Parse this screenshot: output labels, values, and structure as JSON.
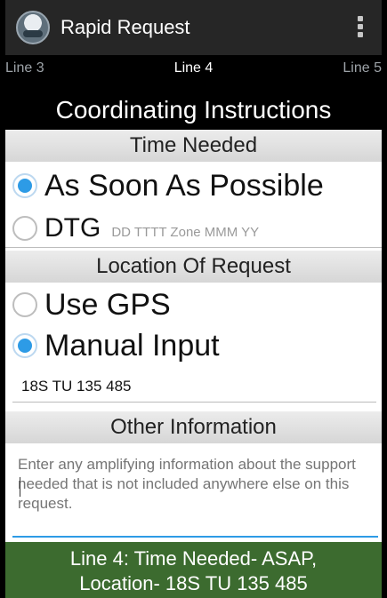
{
  "app": {
    "title": "Rapid Request"
  },
  "tabs": {
    "left": "Line 3",
    "center": "Line 4",
    "right": "Line 5"
  },
  "screen_title": "Coordinating Instructions",
  "time_needed": {
    "header": "Time Needed",
    "options": [
      {
        "label": "As Soon As Possible",
        "checked": true
      },
      {
        "label": "DTG",
        "hint": "DD TTTT Zone MMM YY",
        "checked": false
      }
    ]
  },
  "location": {
    "header": "Location Of Request",
    "options": [
      {
        "label": "Use GPS",
        "checked": false
      },
      {
        "label": "Manual Input",
        "checked": true
      }
    ],
    "manual_value": "18S TU 135 485"
  },
  "other_information": {
    "header": "Other Information",
    "placeholder": "Enter any amplifying information about the support needed that is not included anywhere else on this request."
  },
  "status": {
    "line1": "Line 4: Time Needed- ASAP,",
    "line2": "Location- 18S TU 135 485"
  },
  "colors": {
    "accent": "#2d9be6",
    "status_bg": "#3c6b2f",
    "header_bg": "#262626"
  }
}
